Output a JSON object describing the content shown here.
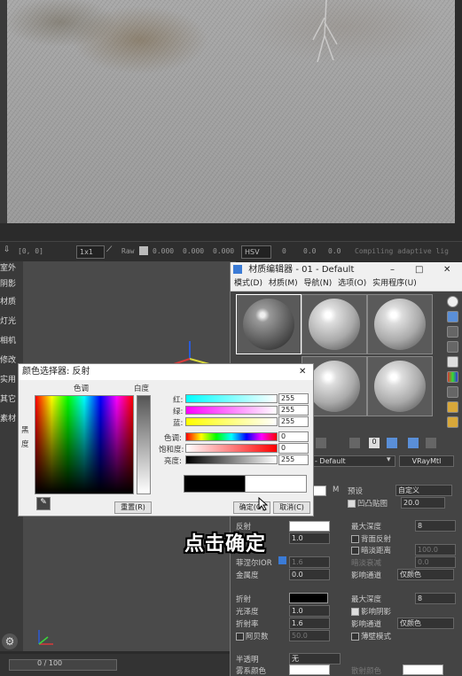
{
  "vfb": {
    "coords": "[0, 0]",
    "zoom": "1x1",
    "mode_raw": "Raw",
    "r": "0.000",
    "g": "0.000",
    "b": "0.000",
    "color_space": "HSV",
    "h": "0",
    "s": "0.0",
    "v": "0.0",
    "status": "Compiling adaptive lig"
  },
  "left_panel": [
    "室外",
    "阴影",
    "材质",
    "灯光",
    "相机",
    "修改",
    "实用",
    "其它",
    "素材"
  ],
  "material_editor": {
    "title": "材质编辑器 - 01 - Default",
    "menu": [
      "模式(D)",
      "材质(M)",
      "导航(N)",
      "选项(O)",
      "实用程序(U)"
    ],
    "material_name": "- Default",
    "material_type": "VRayMtl",
    "preset_label": "预设",
    "preset_value": "自定义",
    "m_label": "M",
    "convex_label": "凹凸贴图",
    "convex_value": "20.0",
    "reflect": {
      "label": "反射",
      "gloss_value": "1.0",
      "max_depth_label": "最大深度",
      "max_depth": "8",
      "back_reflect": "背面反射",
      "dim_distance": "暗淡距离",
      "dim_value": "100.0",
      "fresnel_label": "菲涅尔IOR",
      "fresnel_value": "1.6",
      "dim_falloff": "暗淡衰减",
      "dim_falloff_value": "0.0",
      "metalness_label": "金属度",
      "metalness_value": "0.0",
      "affect_channels": "影响通道",
      "affect_value": "仅颜色"
    },
    "refract": {
      "label": "折射",
      "max_depth_label": "最大深度",
      "max_depth": "8",
      "gloss_label": "光泽度",
      "gloss_value": "1.0",
      "affect_shadows": "影响阴影",
      "ior_label": "折射率",
      "ior_value": "1.6",
      "affect_channels": "影响通道",
      "affect_value": "仅颜色",
      "abbe_label": "阿贝数",
      "abbe_value": "50.0",
      "thin_walled": "薄壁模式"
    },
    "translucency": {
      "label": "半透明",
      "value": "无",
      "scatter_label": "雾系颜色",
      "scatter_color_label": "散射颜色"
    }
  },
  "color_dialog": {
    "title": "颜色选择器: 反射",
    "hue_label": "色调",
    "white_label": "白度",
    "black_label": "黑",
    "degree_label": "度",
    "red_label": "红:",
    "green_label": "绿:",
    "blue_label": "蓝:",
    "red_value": "255",
    "green_value": "255",
    "blue_value": "255",
    "hue_val_label": "色调:",
    "sat_label": "饱和度:",
    "bright_label": "亮度:",
    "hue_value": "0",
    "sat_value": "0",
    "bright_value": "255",
    "reset": "重置(R)",
    "ok": "确定(O)",
    "cancel": "取消(C)"
  },
  "subtitle": "点击确定",
  "timeline": {
    "frames": "0 / 100"
  }
}
